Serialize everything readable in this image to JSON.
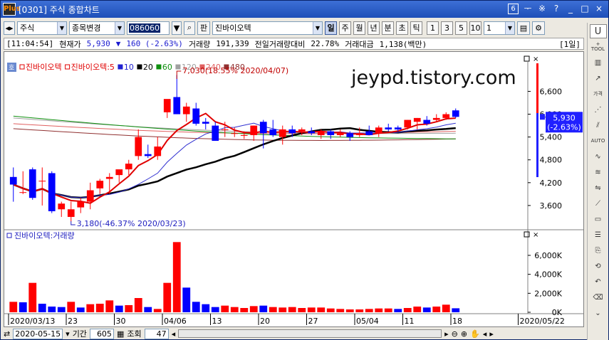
{
  "window": {
    "logo": "Plus",
    "title": "[0301] 주식 종합차트",
    "screen_no": "6",
    "controls": [
      "ᅮ",
      "※",
      "?",
      "_",
      "□",
      "×"
    ]
  },
  "toolbar": {
    "market": "주식",
    "change_label": "종목변경",
    "code": "086060",
    "pan_label": "판",
    "stock_name": "진바이오텍",
    "periods": [
      "일",
      "주",
      "월",
      "년",
      "분",
      "초",
      "틱"
    ],
    "active_period": "일",
    "numbers": [
      "1",
      "3",
      "5",
      "10"
    ],
    "unit_value": "1"
  },
  "infobar": {
    "time": "[11:04:54]",
    "current_label": "현재가",
    "current_price": "5,930",
    "direction": "▼",
    "change": "160 (-2.63%)",
    "volume_label": "거래량",
    "volume": "191,339",
    "prev_ratio_label": "전일거래량대비",
    "prev_ratio": "22.78%",
    "amount_label": "거래대금",
    "amount": "1,138(백만)",
    "period_badge": "[1일]"
  },
  "chart_data": [
    {
      "type": "candlestick",
      "title": "진바이오텍",
      "legend": [
        {
          "name": "진바이오텍",
          "color": "#e00000"
        },
        {
          "name": "진바이오텍:5",
          "color": "#e00000"
        },
        {
          "name": "10",
          "color": "#2020d0"
        },
        {
          "name": "20",
          "color": "#000000"
        },
        {
          "name": "60",
          "color": "#109010"
        },
        {
          "name": "120",
          "color": "#a0a0a0"
        },
        {
          "name": "240",
          "color": "#e06060"
        },
        {
          "name": "480",
          "color": "#903030"
        }
      ],
      "ylim": [
        3000,
        7300
      ],
      "y_ticks": [
        "6,600",
        "6,000",
        "5,400",
        "4,800",
        "4,200",
        "3,600"
      ],
      "y_tick_values": [
        6600,
        6000,
        5400,
        4800,
        4200,
        3600
      ],
      "last_price": "5,930",
      "last_change": "(-2.63%)",
      "annotations": [
        {
          "text": "7,030(18.55% 2020/04/07)",
          "index": 17
        },
        {
          "text": "3,180(-46.37% 2020/03/23)",
          "index": 6
        }
      ],
      "candles": [
        {
          "o": 4350,
          "h": 4600,
          "l": 3700,
          "c": 4150
        },
        {
          "o": 3950,
          "h": 4500,
          "l": 3900,
          "c": 3950
        },
        {
          "o": 4550,
          "h": 4600,
          "l": 3750,
          "c": 3800
        },
        {
          "o": 4250,
          "h": 4600,
          "l": 3600,
          "c": 4250
        },
        {
          "o": 4450,
          "h": 4500,
          "l": 3400,
          "c": 3450
        },
        {
          "o": 3500,
          "h": 3700,
          "l": 3300,
          "c": 3650
        },
        {
          "o": 3300,
          "h": 3700,
          "l": 3180,
          "c": 3500
        },
        {
          "o": 3550,
          "h": 3800,
          "l": 3400,
          "c": 3700
        },
        {
          "o": 3700,
          "h": 4200,
          "l": 3500,
          "c": 4000
        },
        {
          "o": 4050,
          "h": 4300,
          "l": 3900,
          "c": 4250
        },
        {
          "o": 4300,
          "h": 4450,
          "l": 3900,
          "c": 4350
        },
        {
          "o": 4400,
          "h": 4500,
          "l": 4200,
          "c": 4550
        },
        {
          "o": 4550,
          "h": 4800,
          "l": 4400,
          "c": 4700
        },
        {
          "o": 4900,
          "h": 5600,
          "l": 4800,
          "c": 5400
        },
        {
          "o": 4950,
          "h": 5200,
          "l": 4850,
          "c": 4900
        },
        {
          "o": 4900,
          "h": 5400,
          "l": 4800,
          "c": 5150
        },
        {
          "o": 6050,
          "h": 6300,
          "l": 5900,
          "c": 6400
        },
        {
          "o": 6450,
          "h": 7030,
          "l": 6000,
          "c": 6000
        },
        {
          "o": 6000,
          "h": 6300,
          "l": 5800,
          "c": 6200
        },
        {
          "o": 6150,
          "h": 6300,
          "l": 5700,
          "c": 5750
        },
        {
          "o": 5800,
          "h": 5900,
          "l": 5600,
          "c": 5750
        },
        {
          "o": 5700,
          "h": 5800,
          "l": 5300,
          "c": 5300
        },
        {
          "o": 5600,
          "h": 5800,
          "l": 5400,
          "c": 5600
        },
        {
          "o": 5500,
          "h": 5650,
          "l": 5400,
          "c": 5500
        },
        {
          "o": 5450,
          "h": 5550,
          "l": 5350,
          "c": 5450
        },
        {
          "o": 5450,
          "h": 5700,
          "l": 5300,
          "c": 5700
        },
        {
          "o": 5800,
          "h": 5850,
          "l": 5100,
          "c": 5500
        },
        {
          "o": 5600,
          "h": 5850,
          "l": 5400,
          "c": 5450
        },
        {
          "o": 5400,
          "h": 5700,
          "l": 5200,
          "c": 5600
        },
        {
          "o": 5600,
          "h": 5700,
          "l": 5400,
          "c": 5500
        },
        {
          "o": 5550,
          "h": 5650,
          "l": 5450,
          "c": 5600
        },
        {
          "o": 5550,
          "h": 5650,
          "l": 5450,
          "c": 5500
        },
        {
          "o": 5450,
          "h": 5600,
          "l": 5350,
          "c": 5550
        },
        {
          "o": 5550,
          "h": 5600,
          "l": 5350,
          "c": 5450
        },
        {
          "o": 5450,
          "h": 5600,
          "l": 5400,
          "c": 5500
        },
        {
          "o": 5500,
          "h": 5550,
          "l": 5300,
          "c": 5400
        },
        {
          "o": 5450,
          "h": 5650,
          "l": 5400,
          "c": 5500
        },
        {
          "o": 5550,
          "h": 5700,
          "l": 5450,
          "c": 5450
        },
        {
          "o": 5500,
          "h": 5700,
          "l": 5400,
          "c": 5650
        },
        {
          "o": 5650,
          "h": 5750,
          "l": 5550,
          "c": 5600
        },
        {
          "o": 5650,
          "h": 5700,
          "l": 5550,
          "c": 5600
        },
        {
          "o": 5650,
          "h": 5850,
          "l": 5600,
          "c": 5850
        },
        {
          "o": 5800,
          "h": 5900,
          "l": 5600,
          "c": 5900
        },
        {
          "o": 5850,
          "h": 5950,
          "l": 5700,
          "c": 5750
        },
        {
          "o": 5850,
          "h": 6000,
          "l": 5800,
          "c": 5900
        },
        {
          "o": 5900,
          "h": 6050,
          "l": 5850,
          "c": 6000
        },
        {
          "o": 6100,
          "h": 6150,
          "l": 5900,
          "c": 5930
        }
      ]
    },
    {
      "type": "bar",
      "title": "진바이오텍:거래량",
      "ylim": [
        0,
        7800000
      ],
      "y_ticks": [
        "6,000K",
        "4,000K",
        "2,000K",
        "0K"
      ],
      "y_tick_values": [
        6000000,
        4000000,
        2000000,
        0
      ],
      "values": [
        1100000,
        1050000,
        3100000,
        900000,
        600000,
        550000,
        1100000,
        500000,
        850000,
        900000,
        1250000,
        700000,
        750000,
        1500000,
        550000,
        350000,
        3100000,
        7400000,
        2600000,
        1100000,
        850000,
        550000,
        700000,
        550000,
        450000,
        650000,
        700000,
        550000,
        500000,
        550000,
        450000,
        500000,
        500000,
        400000,
        350000,
        300000,
        300000,
        350000,
        400000,
        400000,
        350000,
        450000,
        600000,
        500000,
        600000,
        800000,
        420000
      ],
      "colors_up_down": [
        "up",
        "down",
        "up",
        "down",
        "down",
        "down",
        "up",
        "down",
        "up",
        "up",
        "up",
        "down",
        "up",
        "up",
        "down",
        "up",
        "up",
        "up",
        "down",
        "down",
        "down",
        "down",
        "up",
        "up",
        "up",
        "up",
        "down",
        "up",
        "up",
        "up",
        "up",
        "up",
        "up",
        "up",
        "up",
        "up",
        "up",
        "up",
        "up",
        "up",
        "down",
        "up",
        "up",
        "down",
        "up",
        "up",
        "down"
      ]
    }
  ],
  "x_axis": {
    "labels": [
      "2020/03/13",
      "23",
      "30",
      "04/06",
      "13",
      "20",
      "27",
      "05/04",
      "11",
      "18",
      "2020/05/22"
    ],
    "label_index": [
      0,
      6,
      11,
      16,
      21,
      26,
      31,
      36,
      41,
      46,
      53
    ]
  },
  "watermark": "jeypd.tistory.com",
  "bottombar": {
    "date": "2020-05-15",
    "period_label": "기간",
    "period_value": "605",
    "view_label": "조회",
    "view_value": "47"
  },
  "colors": {
    "up": "#ff0000",
    "down": "#0000ff",
    "ma5": "#e00000",
    "ma10": "#3030d0",
    "ma20": "#000000",
    "ma60": "#109010",
    "ma120": "#a0a0a0",
    "ma240": "#e06060",
    "ma480": "#903030"
  },
  "sidebar": [
    "U",
    "TOOL",
    "차트",
    "추세",
    "가격",
    "패턴",
    "AUTO",
    "지표",
    "비교",
    "분석",
    "표시",
    "설정",
    "복사",
    "초기화",
    "되돌림",
    "화면",
    "더보기"
  ]
}
